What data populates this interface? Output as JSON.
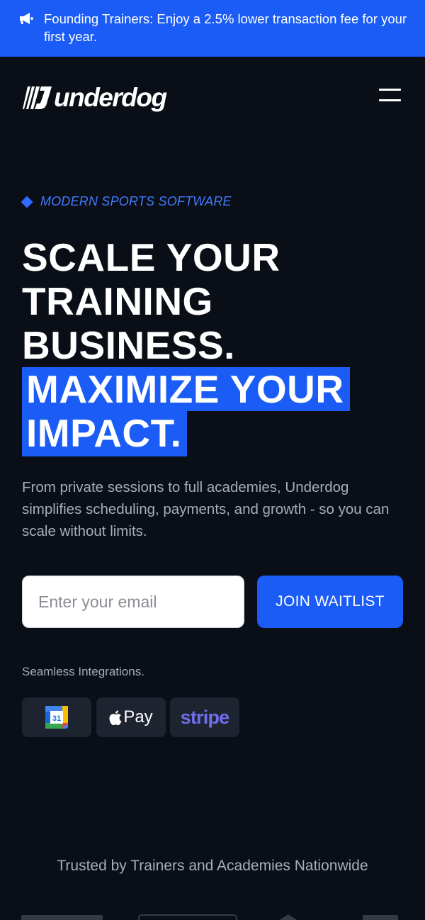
{
  "banner": {
    "text": "Founding Trainers: Enjoy a 2.5% lower transaction fee for your first year.",
    "icon": "megaphone-icon"
  },
  "header": {
    "logo_text": "underdog",
    "menu_icon": "hamburger-menu-icon"
  },
  "hero": {
    "eyebrow": "MODERN SPORTS SOFTWARE",
    "headline_lines": [
      "SCALE YOUR",
      "TRAINING",
      "BUSINESS."
    ],
    "highlight_lines": [
      "MAXIMIZE YOUR",
      "IMPACT."
    ],
    "subcopy": "From private sessions to full academies, Underdog simplifies scheduling, payments, and growth - so you can scale without limits."
  },
  "signup": {
    "email_placeholder": "Enter your email",
    "email_value": "",
    "button_label": "JOIN WAITLIST"
  },
  "integrations": {
    "label": "Seamless Integrations.",
    "items": [
      {
        "name": "google-calendar-icon",
        "text": "31"
      },
      {
        "name": "apple-pay-icon",
        "text": "Pay"
      },
      {
        "name": "stripe-logo",
        "text": "stripe"
      }
    ]
  },
  "trusted": {
    "text": "Trusted by Trainers and Academies Nationwide"
  },
  "colors": {
    "brand_blue": "#1a5cf5",
    "background": "#0a0e16",
    "eyebrow_blue": "#3f7bff",
    "muted_text": "#a9adb8",
    "stripe_purple": "#6f6ee8"
  }
}
